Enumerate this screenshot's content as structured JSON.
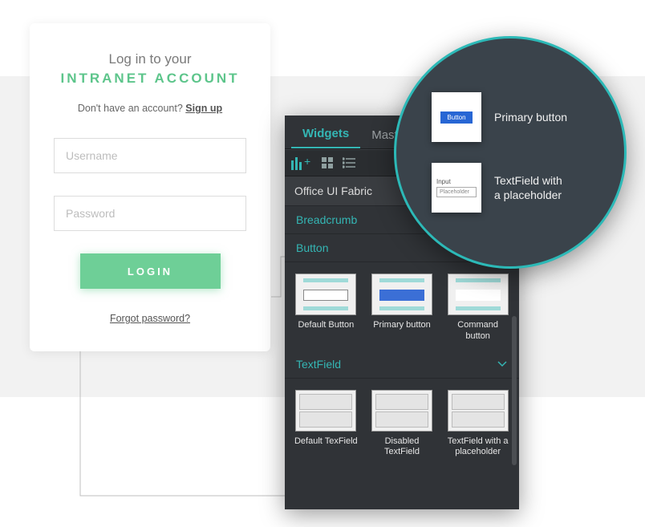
{
  "login": {
    "title_line1": "Log in to your",
    "title_line2": "INTRANET ACCOUNT",
    "signup_prompt": "Don't have an account? ",
    "signup_link": "Sign up",
    "username_placeholder": "Username",
    "password_placeholder": "Password",
    "login_label": "LOGIN",
    "forgot_label": "Forgot password?"
  },
  "panel": {
    "tabs": {
      "widgets": "Widgets",
      "masters": "Master"
    },
    "library_header": "Office UI Fabric",
    "sections": {
      "breadcrumb": "Breadcrumb",
      "button": "Button",
      "textfield": "TextField"
    },
    "tiles": {
      "default_button": "Default Button",
      "primary_button": "Primary button",
      "command_button": "Command button",
      "default_textfield": "Default TexField",
      "disabled_textfield": "Disabled TextField",
      "textfield_placeholder": "TextField with a placeholder"
    }
  },
  "callout": {
    "primary_button": "Primary button",
    "swatch_button_label": "Button",
    "textfield_line1": "TextField with",
    "textfield_line2": "a placeholder",
    "swatch_input_label": "Input",
    "swatch_input_placeholder": "Placeholder"
  }
}
